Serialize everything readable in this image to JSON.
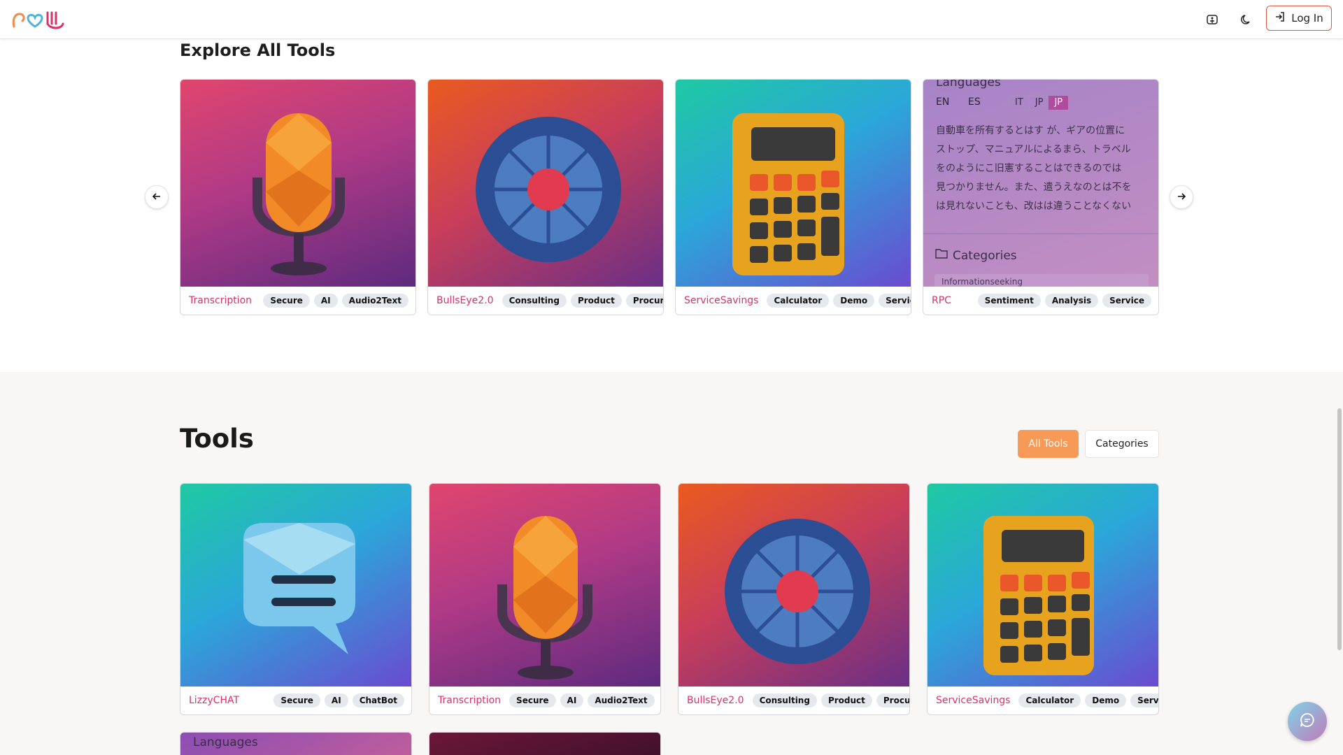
{
  "header": {
    "login_label": "Log In",
    "icons": [
      "accessibility-icon",
      "moon-icon",
      "login-icon"
    ]
  },
  "explore": {
    "title": "Explore All Tools",
    "cards": [
      {
        "name": "Transcription",
        "tags": [
          "Secure",
          "AI",
          "Audio2Text"
        ],
        "art": "microphone"
      },
      {
        "name": "BullsEye2.0",
        "tags": [
          "Consulting",
          "Product",
          "Procurement"
        ],
        "art": "target"
      },
      {
        "name": "ServiceSavings",
        "tags": [
          "Calculator",
          "Demo",
          "Service"
        ],
        "art": "calculator"
      },
      {
        "name": "RPC",
        "tags": [
          "Sentiment",
          "Analysis",
          "Service"
        ],
        "art": "languages"
      }
    ],
    "languages_card": {
      "heading": "Languages",
      "langs": [
        "EN",
        "ES",
        "IT",
        "JP",
        "JP"
      ],
      "text_lines": [
        "自動車を所有するとはす が、ギアの位置に",
        "ストップ、マニュアルによるまら、トラベル",
        "をのようにこ旧憲することはできるのでは",
        "見つかりません。また、遣うえなのとは不を",
        "は見れないことも、改はは違うことなくない"
      ],
      "categories_label": "Categories",
      "category_item": "Informationseeking"
    }
  },
  "tools": {
    "title": "Tools",
    "filters": {
      "all": "All Tools",
      "categories": "Categories"
    },
    "cards": [
      {
        "name": "LizzyCHAT",
        "tags": [
          "Secure",
          "AI",
          "ChatBot"
        ],
        "art": "chat"
      },
      {
        "name": "Transcription",
        "tags": [
          "Secure",
          "AI",
          "Audio2Text"
        ],
        "art": "microphone"
      },
      {
        "name": "BullsEye2.0",
        "tags": [
          "Consulting",
          "Product",
          "Procurement"
        ],
        "art": "target"
      },
      {
        "name": "ServiceSavings",
        "tags": [
          "Calculator",
          "Demo",
          "Service"
        ],
        "art": "calculator"
      }
    ],
    "partial_card_heading": "Languages"
  },
  "colors": {
    "accent": "#d8336a",
    "login_border": "#e0553d",
    "all_tools_bg": "#f79a58"
  }
}
